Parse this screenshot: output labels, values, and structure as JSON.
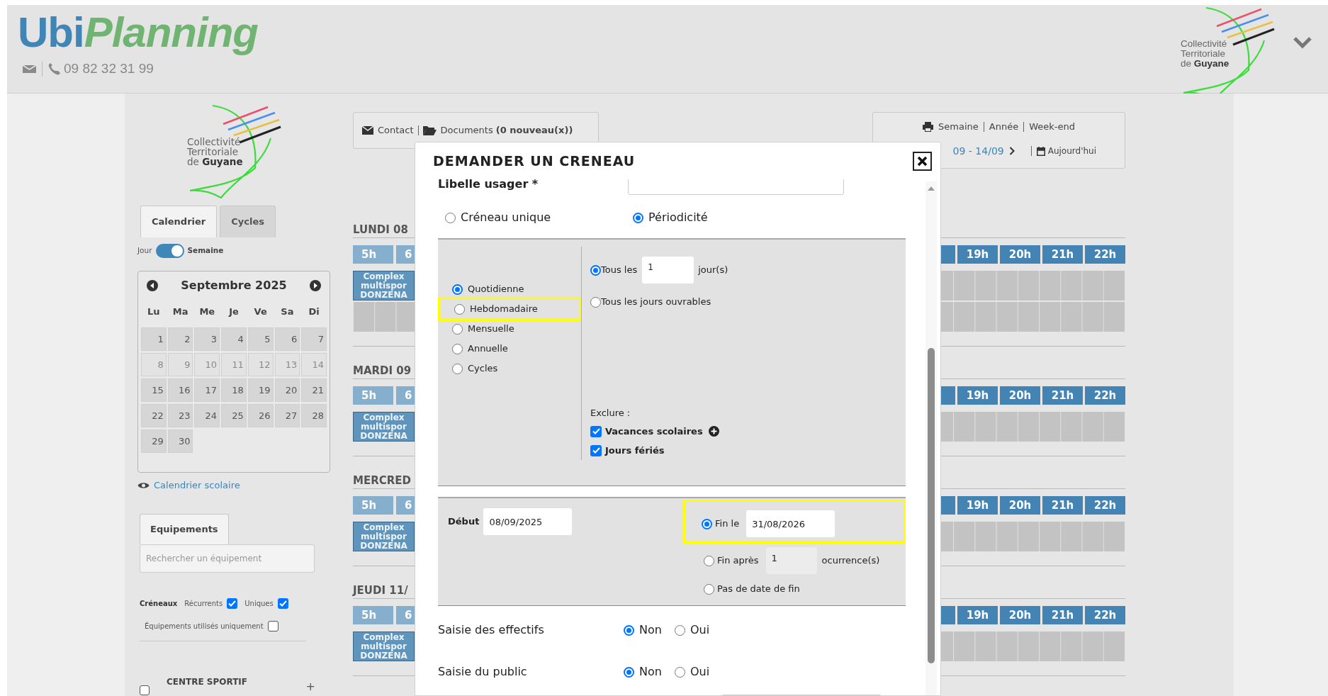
{
  "header": {
    "app_name": [
      "Ubi",
      "Planning"
    ],
    "phone": "09 82 32 31 99",
    "org_logo": [
      "Collectivité",
      "Territoriale",
      "de **Guyane**"
    ]
  },
  "sidebar": {
    "org_logo": [
      "Collectivité",
      "Territoriale",
      "de **Guyane**"
    ],
    "tabs": [
      {
        "label": "Calendrier",
        "selected": true
      },
      {
        "label": "Cycles",
        "selected": false
      }
    ],
    "view_toggle": {
      "off_label": "Jour",
      "on_label": "Semaine",
      "on": true
    },
    "calendar": {
      "month": "Septembre 2025",
      "weekdays": [
        "Lu",
        "Ma",
        "Me",
        "Je",
        "Ve",
        "Sa",
        "Di"
      ],
      "days": [
        {
          "label": "1",
          "disabled": false
        },
        {
          "label": "2",
          "disabled": false
        },
        {
          "label": "3",
          "disabled": false
        },
        {
          "label": "4",
          "disabled": false
        },
        {
          "label": "5",
          "disabled": false
        },
        {
          "label": "6",
          "disabled": false
        },
        {
          "label": "7",
          "disabled": false
        },
        {
          "label": "8",
          "disabled": true
        },
        {
          "label": "9",
          "disabled": true
        },
        {
          "label": "10",
          "disabled": true
        },
        {
          "label": "11",
          "disabled": true
        },
        {
          "label": "12",
          "disabled": true
        },
        {
          "label": "13",
          "disabled": true
        },
        {
          "label": "14",
          "disabled": true
        },
        {
          "label": "15",
          "disabled": false
        },
        {
          "label": "16",
          "disabled": false
        },
        {
          "label": "17",
          "disabled": false
        },
        {
          "label": "18",
          "disabled": false
        },
        {
          "label": "19",
          "disabled": false
        },
        {
          "label": "20",
          "disabled": false
        },
        {
          "label": "21",
          "disabled": false
        },
        {
          "label": "22",
          "disabled": false
        },
        {
          "label": "23",
          "disabled": false
        },
        {
          "label": "24",
          "disabled": false
        },
        {
          "label": "25",
          "disabled": false
        },
        {
          "label": "26",
          "disabled": false
        },
        {
          "label": "27",
          "disabled": false
        },
        {
          "label": "28",
          "disabled": false
        },
        {
          "label": "29",
          "disabled": false
        },
        {
          "label": "30",
          "disabled": false
        }
      ]
    },
    "school_calendar_link": "Calendrier scolaire",
    "equipment_tab": {
      "label": "Equipements",
      "selected": true
    },
    "equipment_search": {
      "placeholder": "Rechercher un équipement"
    },
    "filters": {
      "label": "Créneaux",
      "options": [
        {
          "label": "Récurrents",
          "checked": true
        },
        {
          "label": "Uniques",
          "checked": true
        }
      ]
    },
    "used_only": {
      "label": "Équipements utilisés uniquement",
      "checked": false
    },
    "groups": [
      {
        "label": "CENTRE SPORTIF",
        "checked": false,
        "action": "+"
      }
    ]
  },
  "toolbar": {
    "contact": "Contact",
    "documents": "Documents **(0 nouveau(x))**",
    "views": [
      "Semaine",
      "Année",
      "Week-end"
    ],
    "range": "09 - 14/09",
    "today": "Aujourd'hui"
  },
  "days": [
    {
      "title": "LUNDI 08",
      "hours": [
        {
          "label": "5h",
          "disabled": true
        },
        {
          "label": "6",
          "disabled": true
        },
        {
          "label": "19h",
          "disabled": false
        },
        {
          "label": "20h",
          "disabled": false
        },
        {
          "label": "21h",
          "disabled": false
        },
        {
          "label": "22h",
          "disabled": false
        }
      ],
      "rows": [
        {
          "kind": "booked",
          "booking": [
            "Complex",
            "multispor",
            "DONZENA"
          ]
        },
        {
          "kind": "free"
        }
      ]
    },
    {
      "title": "MARDI 09",
      "hours": [
        {
          "label": "5h",
          "disabled": true
        },
        {
          "label": "6",
          "disabled": true
        },
        {
          "label": "19h",
          "disabled": false
        },
        {
          "label": "20h",
          "disabled": false
        },
        {
          "label": "21h",
          "disabled": false
        },
        {
          "label": "22h",
          "disabled": false
        }
      ],
      "rows": [
        {
          "kind": "booked",
          "booking": [
            "Complex",
            "multispor",
            "DONZENA"
          ]
        }
      ]
    },
    {
      "title": "MERCRED",
      "hours": [
        {
          "label": "5h",
          "disabled": true
        },
        {
          "label": "6",
          "disabled": true
        },
        {
          "label": "19h",
          "disabled": false
        },
        {
          "label": "20h",
          "disabled": false
        },
        {
          "label": "21h",
          "disabled": false
        },
        {
          "label": "22h",
          "disabled": false
        }
      ],
      "rows": [
        {
          "kind": "booked",
          "booking": [
            "Complex",
            "multispor",
            "DONZENA"
          ]
        }
      ]
    },
    {
      "title": "JEUDI 11/",
      "hours": [
        {
          "label": "5h",
          "disabled": true
        },
        {
          "label": "6",
          "disabled": true
        },
        {
          "label": "19h",
          "disabled": false
        },
        {
          "label": "20h",
          "disabled": false
        },
        {
          "label": "21h",
          "disabled": false
        },
        {
          "label": "22h",
          "disabled": false
        }
      ],
      "rows": [
        {
          "kind": "booked",
          "booking": [
            "Complex",
            "multispor",
            "DONZENA"
          ]
        }
      ]
    }
  ],
  "modal": {
    "title": "DEMANDER UN CRENEAU",
    "user_label": "Libelle usager *",
    "mode_options": [
      {
        "label": "Créneau unique",
        "selected": false
      },
      {
        "label": "Périodicité",
        "selected": true
      }
    ],
    "frequency_options": [
      {
        "label": "Quotidienne",
        "selected": true,
        "highlighted": false
      },
      {
        "label": "Hebdomadaire",
        "selected": false,
        "highlighted": true
      },
      {
        "label": "Mensuelle",
        "selected": false,
        "highlighted": false
      },
      {
        "label": "Annuelle",
        "selected": false,
        "highlighted": false
      },
      {
        "label": "Cycles",
        "selected": false,
        "highlighted": false
      }
    ],
    "daily_options": [
      {
        "kind": "interval",
        "label": "Tous les",
        "value": "1",
        "unit": "jour(s)",
        "selected": true
      },
      {
        "kind": "plain",
        "label": "Tous les jours ouvrables",
        "selected": false
      }
    ],
    "exclude": {
      "label": "Exclure :",
      "options": [
        {
          "label": "Vacances scolaires",
          "checked": true,
          "has_info": true
        },
        {
          "label": "Jours fériés",
          "checked": true,
          "has_info": false
        }
      ]
    },
    "start": {
      "label": "Début",
      "value": "08/09/2025"
    },
    "end_options": [
      {
        "kind": "date",
        "label": "Fin le",
        "value": "31/08/2026",
        "selected": true,
        "highlighted": true
      },
      {
        "kind": "count",
        "label": "Fin après",
        "value": "1",
        "unit": "ocurrence(s)",
        "selected": false,
        "highlighted": false
      },
      {
        "kind": "none",
        "label": "Pas de date de fin",
        "selected": false,
        "highlighted": false
      }
    ],
    "questions": [
      {
        "label": "Saisie des effectifs",
        "options": [
          {
            "label": "Non",
            "selected": true
          },
          {
            "label": "Oui",
            "selected": false
          }
        ]
      },
      {
        "label": "Saisie du public",
        "options": [
          {
            "label": "Non",
            "selected": true
          },
          {
            "label": "Oui",
            "selected": false
          }
        ]
      }
    ]
  }
}
